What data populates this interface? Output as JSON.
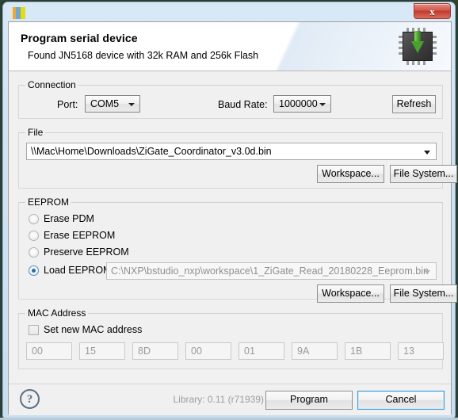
{
  "window": {
    "icon": "app-bars-icon",
    "close_label": "x"
  },
  "header": {
    "title": "Program serial device",
    "description": "Found JN5168 device with 32k RAM and 256k Flash",
    "icon": "chip-download-arrow-icon"
  },
  "connection": {
    "legend": "Connection",
    "port_label": "Port:",
    "port_value": "COM5",
    "baud_label": "Baud Rate:",
    "baud_value": "1000000",
    "refresh_label": "Refresh"
  },
  "file": {
    "legend": "File",
    "path_value": "\\\\Mac\\Home\\Downloads\\ZiGate_Coordinator_v3.0d.bin",
    "workspace_label": "Workspace...",
    "filesystem_label": "File System..."
  },
  "eeprom": {
    "legend": "EEPROM",
    "options": [
      {
        "label": "Erase PDM",
        "selected": false
      },
      {
        "label": "Erase EEPROM",
        "selected": false
      },
      {
        "label": "Preserve EEPROM",
        "selected": false
      },
      {
        "label": "Load EEPROM:",
        "selected": true
      }
    ],
    "load_path_value": "C:\\NXP\\bstudio_nxp\\workspace\\1_ZiGate_Read_20180228_Eeprom.bin",
    "workspace_label": "Workspace...",
    "filesystem_label": "File System..."
  },
  "mac": {
    "legend": "MAC Address",
    "checkbox_label": "Set new MAC address",
    "checkbox_checked": false,
    "octets": [
      "00",
      "15",
      "8D",
      "00",
      "01",
      "9A",
      "1B",
      "13"
    ]
  },
  "footer": {
    "help_label": "?",
    "library_text": "Library: 0.11 (r71939)",
    "program_label": "Program",
    "cancel_label": "Cancel"
  },
  "colors": {
    "accent": "#3c9ad6",
    "close_red": "#c0392c",
    "arrow_green": "#48a22c"
  }
}
